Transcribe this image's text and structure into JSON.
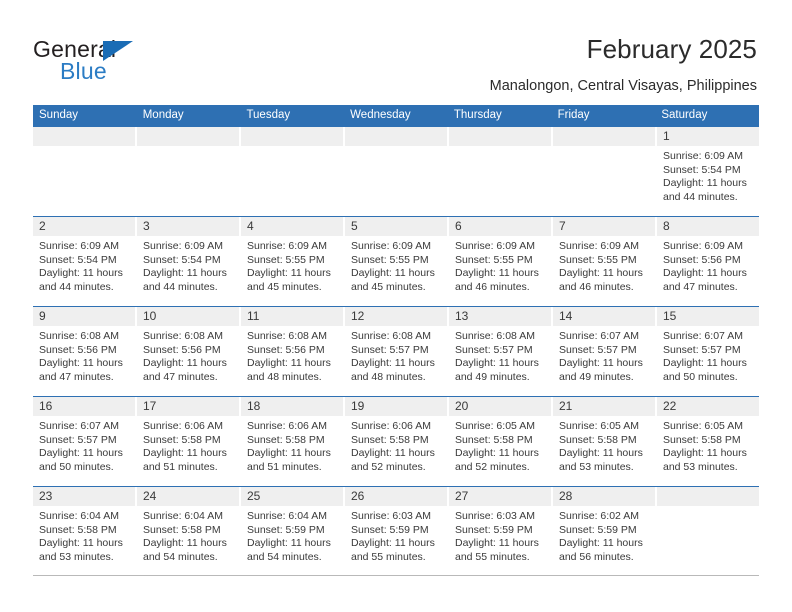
{
  "brand": {
    "name_primary": "General",
    "name_secondary": "Blue",
    "triangle_icon": "triangle-icon",
    "accent_color": "#2b7cc4"
  },
  "header": {
    "title": "February 2025",
    "subtitle": "Manalongon, Central Visayas, Philippines",
    "header_bg_color": "#2e70b3"
  },
  "weekdays": [
    "Sunday",
    "Monday",
    "Tuesday",
    "Wednesday",
    "Thursday",
    "Friday",
    "Saturday"
  ],
  "labels": {
    "sunrise": "Sunrise:",
    "sunset": "Sunset:",
    "daylight": "Daylight:"
  },
  "weeks": [
    [
      {
        "day": "",
        "empty": true
      },
      {
        "day": "",
        "empty": true
      },
      {
        "day": "",
        "empty": true
      },
      {
        "day": "",
        "empty": true
      },
      {
        "day": "",
        "empty": true
      },
      {
        "day": "",
        "empty": true
      },
      {
        "day": "1",
        "sunrise": "Sunrise: 6:09 AM",
        "sunset": "Sunset: 5:54 PM",
        "daylight": "Daylight: 11 hours and 44 minutes."
      }
    ],
    [
      {
        "day": "2",
        "sunrise": "Sunrise: 6:09 AM",
        "sunset": "Sunset: 5:54 PM",
        "daylight": "Daylight: 11 hours and 44 minutes."
      },
      {
        "day": "3",
        "sunrise": "Sunrise: 6:09 AM",
        "sunset": "Sunset: 5:54 PM",
        "daylight": "Daylight: 11 hours and 44 minutes."
      },
      {
        "day": "4",
        "sunrise": "Sunrise: 6:09 AM",
        "sunset": "Sunset: 5:55 PM",
        "daylight": "Daylight: 11 hours and 45 minutes."
      },
      {
        "day": "5",
        "sunrise": "Sunrise: 6:09 AM",
        "sunset": "Sunset: 5:55 PM",
        "daylight": "Daylight: 11 hours and 45 minutes."
      },
      {
        "day": "6",
        "sunrise": "Sunrise: 6:09 AM",
        "sunset": "Sunset: 5:55 PM",
        "daylight": "Daylight: 11 hours and 46 minutes."
      },
      {
        "day": "7",
        "sunrise": "Sunrise: 6:09 AM",
        "sunset": "Sunset: 5:55 PM",
        "daylight": "Daylight: 11 hours and 46 minutes."
      },
      {
        "day": "8",
        "sunrise": "Sunrise: 6:09 AM",
        "sunset": "Sunset: 5:56 PM",
        "daylight": "Daylight: 11 hours and 47 minutes."
      }
    ],
    [
      {
        "day": "9",
        "sunrise": "Sunrise: 6:08 AM",
        "sunset": "Sunset: 5:56 PM",
        "daylight": "Daylight: 11 hours and 47 minutes."
      },
      {
        "day": "10",
        "sunrise": "Sunrise: 6:08 AM",
        "sunset": "Sunset: 5:56 PM",
        "daylight": "Daylight: 11 hours and 47 minutes."
      },
      {
        "day": "11",
        "sunrise": "Sunrise: 6:08 AM",
        "sunset": "Sunset: 5:56 PM",
        "daylight": "Daylight: 11 hours and 48 minutes."
      },
      {
        "day": "12",
        "sunrise": "Sunrise: 6:08 AM",
        "sunset": "Sunset: 5:57 PM",
        "daylight": "Daylight: 11 hours and 48 minutes."
      },
      {
        "day": "13",
        "sunrise": "Sunrise: 6:08 AM",
        "sunset": "Sunset: 5:57 PM",
        "daylight": "Daylight: 11 hours and 49 minutes."
      },
      {
        "day": "14",
        "sunrise": "Sunrise: 6:07 AM",
        "sunset": "Sunset: 5:57 PM",
        "daylight": "Daylight: 11 hours and 49 minutes."
      },
      {
        "day": "15",
        "sunrise": "Sunrise: 6:07 AM",
        "sunset": "Sunset: 5:57 PM",
        "daylight": "Daylight: 11 hours and 50 minutes."
      }
    ],
    [
      {
        "day": "16",
        "sunrise": "Sunrise: 6:07 AM",
        "sunset": "Sunset: 5:57 PM",
        "daylight": "Daylight: 11 hours and 50 minutes."
      },
      {
        "day": "17",
        "sunrise": "Sunrise: 6:06 AM",
        "sunset": "Sunset: 5:58 PM",
        "daylight": "Daylight: 11 hours and 51 minutes."
      },
      {
        "day": "18",
        "sunrise": "Sunrise: 6:06 AM",
        "sunset": "Sunset: 5:58 PM",
        "daylight": "Daylight: 11 hours and 51 minutes."
      },
      {
        "day": "19",
        "sunrise": "Sunrise: 6:06 AM",
        "sunset": "Sunset: 5:58 PM",
        "daylight": "Daylight: 11 hours and 52 minutes."
      },
      {
        "day": "20",
        "sunrise": "Sunrise: 6:05 AM",
        "sunset": "Sunset: 5:58 PM",
        "daylight": "Daylight: 11 hours and 52 minutes."
      },
      {
        "day": "21",
        "sunrise": "Sunrise: 6:05 AM",
        "sunset": "Sunset: 5:58 PM",
        "daylight": "Daylight: 11 hours and 53 minutes."
      },
      {
        "day": "22",
        "sunrise": "Sunrise: 6:05 AM",
        "sunset": "Sunset: 5:58 PM",
        "daylight": "Daylight: 11 hours and 53 minutes."
      }
    ],
    [
      {
        "day": "23",
        "sunrise": "Sunrise: 6:04 AM",
        "sunset": "Sunset: 5:58 PM",
        "daylight": "Daylight: 11 hours and 53 minutes."
      },
      {
        "day": "24",
        "sunrise": "Sunrise: 6:04 AM",
        "sunset": "Sunset: 5:58 PM",
        "daylight": "Daylight: 11 hours and 54 minutes."
      },
      {
        "day": "25",
        "sunrise": "Sunrise: 6:04 AM",
        "sunset": "Sunset: 5:59 PM",
        "daylight": "Daylight: 11 hours and 54 minutes."
      },
      {
        "day": "26",
        "sunrise": "Sunrise: 6:03 AM",
        "sunset": "Sunset: 5:59 PM",
        "daylight": "Daylight: 11 hours and 55 minutes."
      },
      {
        "day": "27",
        "sunrise": "Sunrise: 6:03 AM",
        "sunset": "Sunset: 5:59 PM",
        "daylight": "Daylight: 11 hours and 55 minutes."
      },
      {
        "day": "28",
        "sunrise": "Sunrise: 6:02 AM",
        "sunset": "Sunset: 5:59 PM",
        "daylight": "Daylight: 11 hours and 56 minutes."
      },
      {
        "day": "",
        "empty": true
      }
    ]
  ]
}
